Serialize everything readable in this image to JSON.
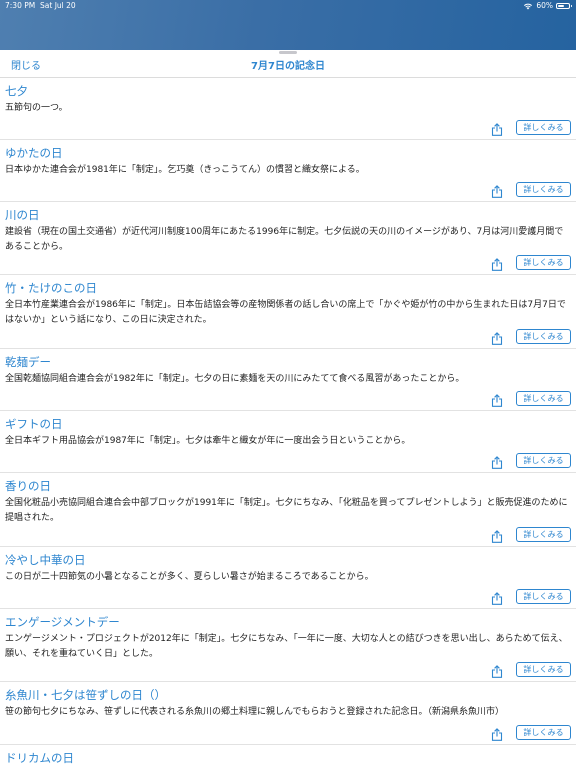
{
  "status_bar": {
    "time": "7:30 PM",
    "date": "Sat Jul 20",
    "battery": "60%",
    "battery_level": 0.6
  },
  "nav": {
    "close_label": "閉じる",
    "title": "7月7日の記念日"
  },
  "more_label": "詳しくみる",
  "entries": [
    {
      "title": "七夕",
      "desc": "五節句の一つ。"
    },
    {
      "title": "ゆかたの日",
      "desc": "日本ゆかた連合会が1981年に「制定」。乞巧奠（きっこうてん）の慣習と織女祭による。"
    },
    {
      "title": "川の日",
      "desc": "建設省（現在の国土交通省）が近代河川制度100周年にあたる1996年に制定。七夕伝説の天の川のイメージがあり、7月は河川愛護月間であることから。"
    },
    {
      "title": "竹・たけのこの日",
      "desc": "全日本竹産業連合会が1986年に「制定」。日本缶詰協会等の産物関係者の話し合いの席上で「かぐや姫が竹の中から生まれた日は7月7日ではないか」という話になり、この日に決定された。"
    },
    {
      "title": "乾麺デー",
      "desc": "全国乾麺協同組合連合会が1982年に「制定」。七夕の日に素麺を天の川にみたてて食べる風習があったことから。"
    },
    {
      "title": "ギフトの日",
      "desc": "全日本ギフト用品協会が1987年に「制定」。七夕は牽牛と織女が年に一度出会う日ということから。"
    },
    {
      "title": "香りの日",
      "desc": "全国化粧品小売協同組合連合会中部ブロックが1991年に「制定」。七夕にちなみ、「化粧品を買ってプレゼントしよう」と販売促進のために提唱された。"
    },
    {
      "title": "冷やし中華の日",
      "desc": "この日が二十四節気の小暑となることが多く、夏らしい暑さが始まるころであることから。"
    },
    {
      "title": "エンゲージメントデー",
      "desc": "エンゲージメント・プロジェクトが2012年に「制定」。七夕にちなみ、「一年に一度、大切な人との結びつきを思い出し、あらためて伝え、願い、それを重ねていく日」とした。"
    },
    {
      "title": "糸魚川・七夕は笹ずしの日（）",
      "desc": "笹の節句七夕にちなみ、笹ずしに代表される糸魚川の郷土料理に親しんでもらおうと登録された記念日。（新潟県糸魚川市）"
    },
    {
      "title": "ドリカムの日",
      "desc": ""
    }
  ]
}
